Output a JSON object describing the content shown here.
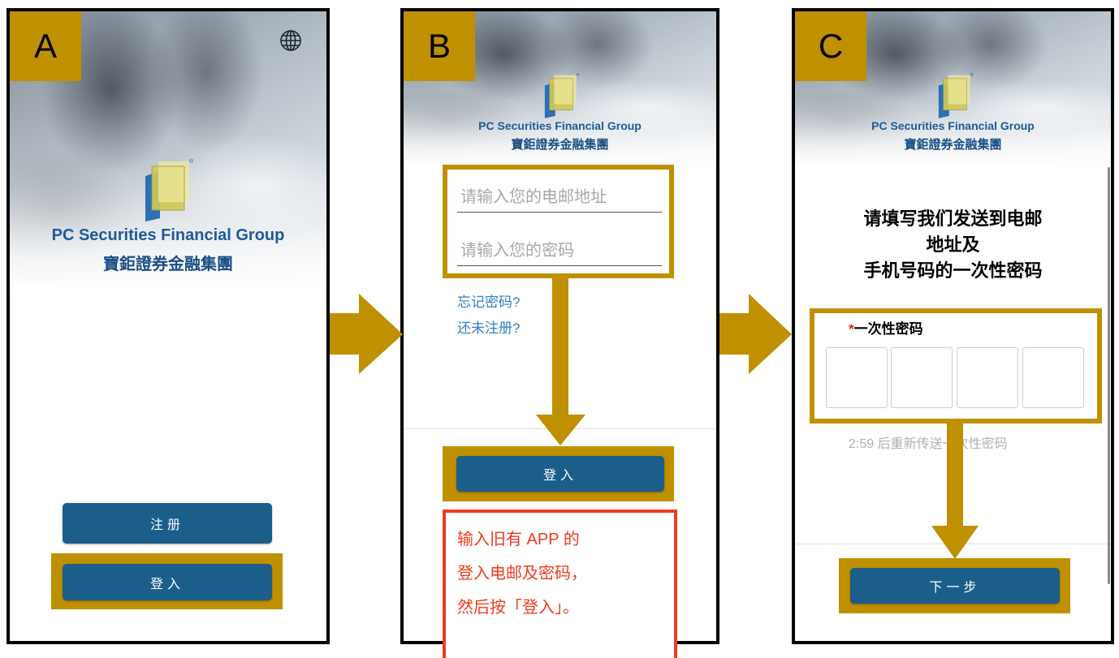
{
  "colors": {
    "accent_gold": "#BF9000",
    "button_blue": "#1B5E8A",
    "brand_blue": "#1D5A9A",
    "link_blue": "#2F80C4",
    "callout_red": "#EE3B1F",
    "required_red": "#E02020"
  },
  "icons": {
    "language": "globe-icon",
    "step_arrow": "arrow-right-icon",
    "flow_arrow": "arrow-down-icon"
  },
  "brand": {
    "name_en": "PC Securities Financial Group",
    "name_zh": "寶鉅證券金融集團",
    "registered_mark": "®"
  },
  "panel_a": {
    "step_label": "A",
    "register_button": "注册",
    "login_button": "登入"
  },
  "panel_b": {
    "step_label": "B",
    "email_field": {
      "value": "",
      "placeholder": "请输入您的电邮地址"
    },
    "password_field": {
      "value": "",
      "placeholder": "请输入您的密码"
    },
    "forgot_password_link": "忘记密码?",
    "not_registered_link": "还未注册?",
    "login_button": "登入",
    "instruction_lines": [
      "输入旧有 APP 的",
      "登入电邮及密码，",
      "然后按「登入」。"
    ]
  },
  "panel_c": {
    "step_label": "C",
    "heading_lines": [
      "请填写我们发送到电邮",
      "地址及",
      "手机号码的一次性密码"
    ],
    "otp_required_mark": "*",
    "otp_label": "一次性密码",
    "otp_values": [
      "",
      "",
      "",
      ""
    ],
    "resend_text": "2:59 后重新传送一次性密码",
    "next_button": "下一步"
  }
}
